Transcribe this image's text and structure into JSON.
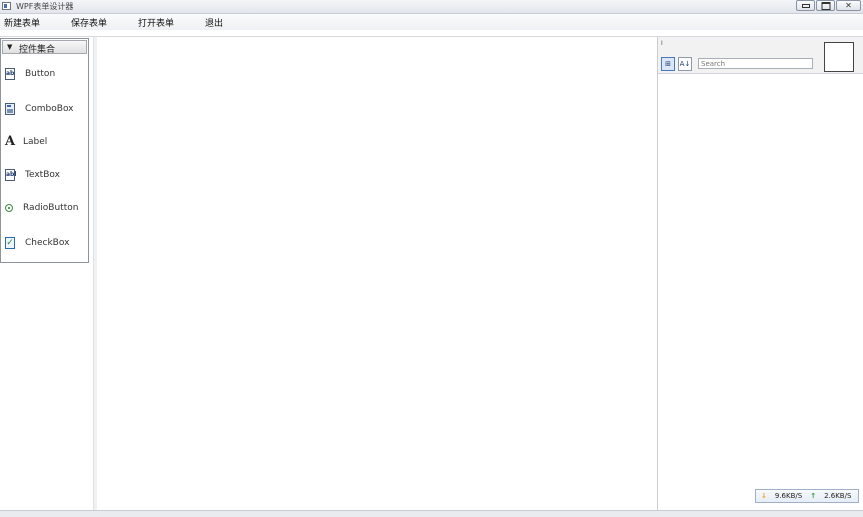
{
  "window": {
    "title": "WPF表单设计器"
  },
  "menu": [
    {
      "id": "new",
      "label": "新建表单"
    },
    {
      "id": "save",
      "label": "保存表单"
    },
    {
      "id": "open",
      "label": "打开表单"
    },
    {
      "id": "exit",
      "label": "退出"
    }
  ],
  "toolbox": {
    "header": "控件集合",
    "items": [
      {
        "label": "Button",
        "icon": "button-icon"
      },
      {
        "label": "ComboBox",
        "icon": "combobox-icon"
      },
      {
        "label": "Label",
        "icon": "label-icon"
      },
      {
        "label": "TextBox",
        "icon": "textbox-icon"
      },
      {
        "label": "RadioButton",
        "icon": "radiobutton-icon"
      },
      {
        "label": "CheckBox",
        "icon": "checkbox-icon"
      }
    ]
  },
  "property_panel": {
    "selected_name": "I",
    "search_placeholder": "Search"
  },
  "network": {
    "download": "9.6KB/S",
    "upload": "2.6KB/S"
  }
}
